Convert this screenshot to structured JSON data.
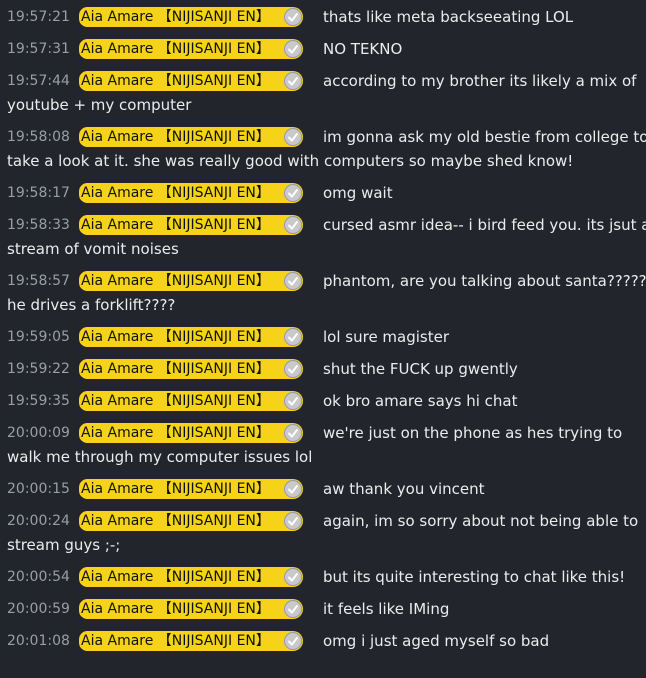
{
  "messages": [
    {
      "time": "19:57:21",
      "author": "Aia Amare 【NIJISANJI EN】",
      "line1": "thats like meta backseeating LOL",
      "line2": ""
    },
    {
      "time": "19:57:31",
      "author": "Aia Amare 【NIJISANJI EN】",
      "line1": "NO TEKNO",
      "line2": ""
    },
    {
      "time": "19:57:44",
      "author": "Aia Amare 【NIJISANJI EN】",
      "line1": "according to my brother its likely a mix of",
      "line2": "youtube + my computer"
    },
    {
      "time": "19:58:08",
      "author": "Aia Amare 【NIJISANJI EN】",
      "line1": "im gonna ask my old bestie from college to",
      "line2": "take a look at it. she was really good with computers so maybe shed know!"
    },
    {
      "time": "19:58:17",
      "author": "Aia Amare 【NIJISANJI EN】",
      "line1": "omg wait",
      "line2": ""
    },
    {
      "time": "19:58:33",
      "author": "Aia Amare 【NIJISANJI EN】",
      "line1": "cursed asmr idea-- i bird feed you. its jsut a",
      "line2": "stream of vomit noises"
    },
    {
      "time": "19:58:57",
      "author": "Aia Amare 【NIJISANJI EN】",
      "line1": "phantom, are you talking about santa?????",
      "line2": "he drives a forklift????"
    },
    {
      "time": "19:59:05",
      "author": "Aia Amare 【NIJISANJI EN】",
      "line1": "lol sure magister",
      "line2": ""
    },
    {
      "time": "19:59:22",
      "author": "Aia Amare 【NIJISANJI EN】",
      "line1": "shut the FUCK up gwently",
      "line2": ""
    },
    {
      "time": "19:59:35",
      "author": "Aia Amare 【NIJISANJI EN】",
      "line1": "ok bro amare says hi chat",
      "line2": ""
    },
    {
      "time": "20:00:09",
      "author": "Aia Amare 【NIJISANJI EN】",
      "line1": "we're just on the phone as hes trying to",
      "line2": "walk me through my computer issues lol"
    },
    {
      "time": "20:00:15",
      "author": "Aia Amare 【NIJISANJI EN】",
      "line1": "aw thank you vincent",
      "line2": ""
    },
    {
      "time": "20:00:24",
      "author": "Aia Amare 【NIJISANJI EN】",
      "line1": "again, im so sorry about not being able to",
      "line2": "stream guys ;-;"
    },
    {
      "time": "20:00:54",
      "author": "Aia Amare 【NIJISANJI EN】",
      "line1": "but its quite interesting to chat like this!",
      "line2": ""
    },
    {
      "time": "20:00:59",
      "author": "Aia Amare 【NIJISANJI EN】",
      "line1": "it feels like IMing",
      "line2": ""
    },
    {
      "time": "20:01:08",
      "author": "Aia Amare 【NIJISANJI EN】",
      "line1": "omg i just aged myself so bad",
      "line2": ""
    }
  ],
  "colors": {
    "background": "#22252b",
    "badge": "#f6d318",
    "timestamp": "#9a9ea6",
    "text": "#ececec"
  },
  "icons": {
    "verified": "verified-check-icon"
  }
}
